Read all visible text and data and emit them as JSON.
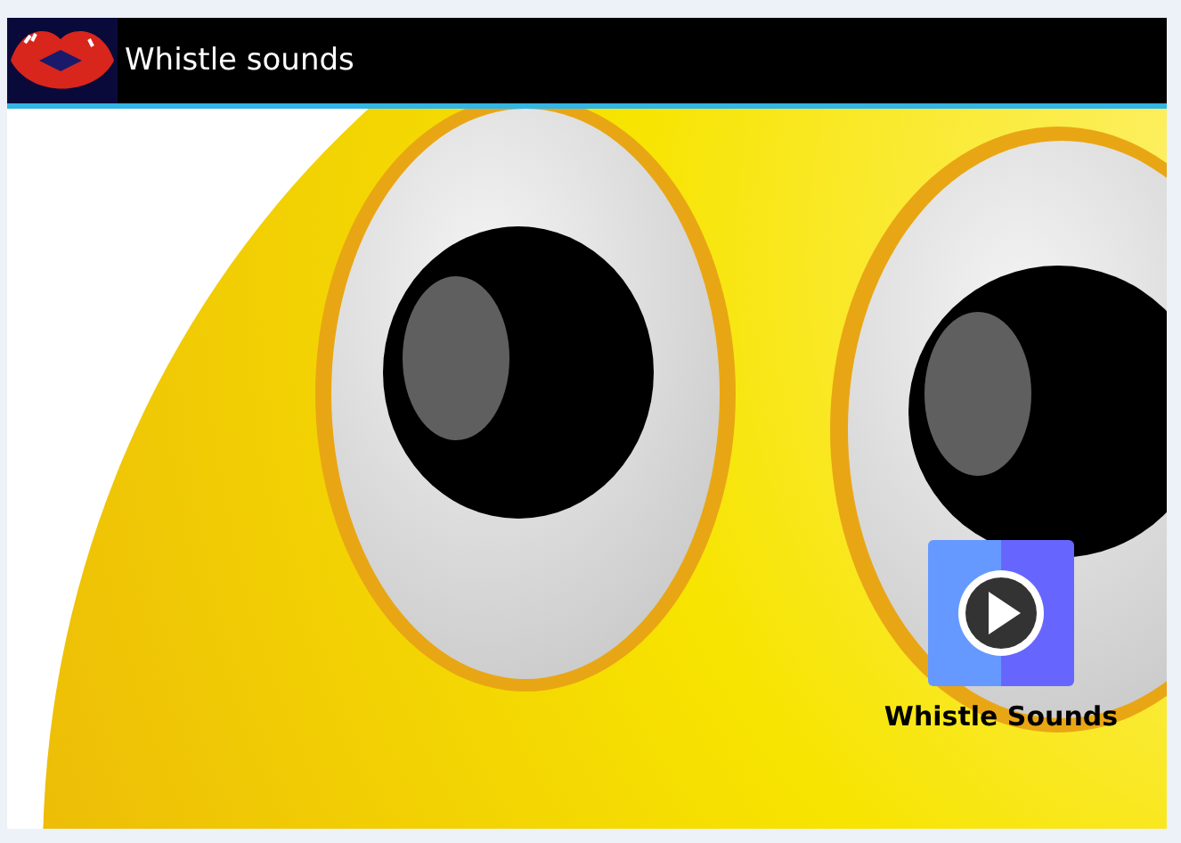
{
  "app_bar": {
    "title": "Whistle sounds"
  },
  "shortcut": {
    "label": "Whistle Sounds"
  }
}
